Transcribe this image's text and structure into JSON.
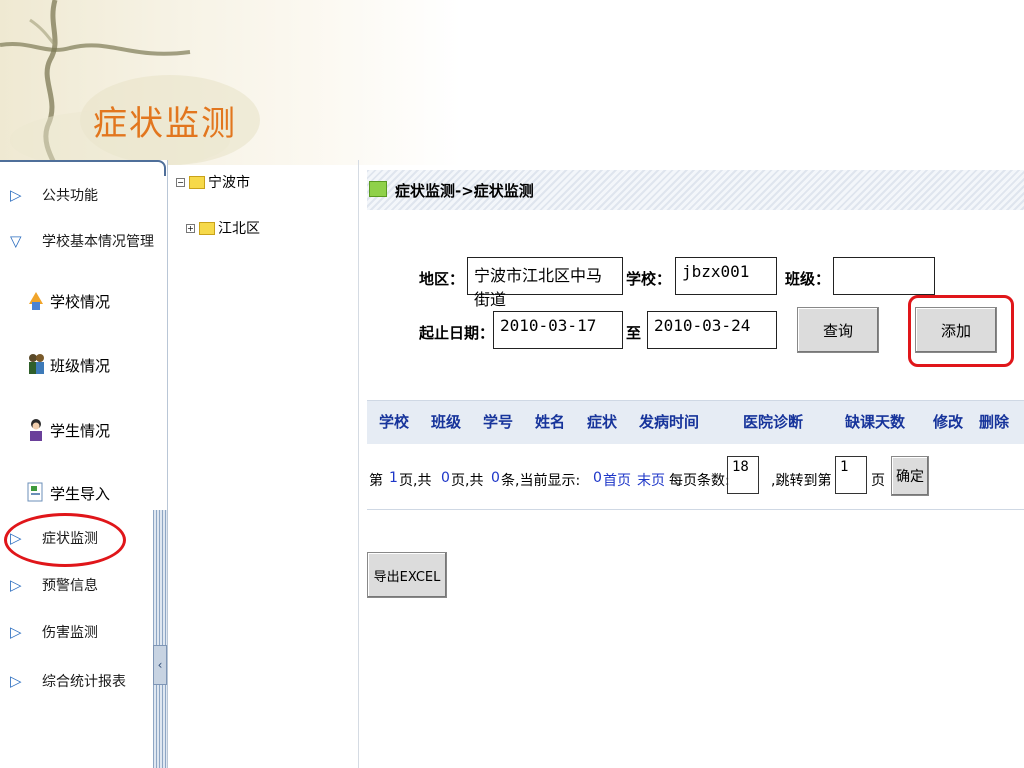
{
  "banner": {
    "title": "症状监测"
  },
  "sidebar": {
    "items": [
      {
        "label": "公共功能",
        "icon": "triangle-right-icon"
      },
      {
        "label": "学校基本情况管理",
        "icon": "triangle-down-icon"
      },
      {
        "label": "症状监测",
        "icon": "triangle-right-icon"
      },
      {
        "label": "预警信息",
        "icon": "triangle-right-icon"
      },
      {
        "label": "伤害监测",
        "icon": "triangle-right-icon"
      },
      {
        "label": "综合统计报表",
        "icon": "triangle-right-icon"
      }
    ],
    "sub_items": [
      {
        "label": "学校情况",
        "icon": "school-icon"
      },
      {
        "label": "班级情况",
        "icon": "class-icon"
      },
      {
        "label": "学生情况",
        "icon": "student-icon"
      },
      {
        "label": "学生导入",
        "icon": "import-icon"
      }
    ],
    "collapse_glyph": "‹"
  },
  "tree": {
    "root": {
      "label": "宁波市",
      "expander": "−"
    },
    "child": {
      "label": "江北区",
      "expander": "+"
    }
  },
  "main": {
    "breadcrumb": "症状监测->症状监测",
    "form": {
      "region_label": "地区：",
      "region_value": "宁波市江北区中马街道",
      "school_label": "学校：",
      "school_value": "jbzx001",
      "class_label": "班级：",
      "class_value": "",
      "date_label": "起止日期：",
      "start_date": "2010-03-17",
      "to_label": "至",
      "end_date": "2010-03-24",
      "query_button": "查询",
      "add_button": "添加"
    },
    "table": {
      "columns": [
        "学校",
        "班级",
        "学号",
        "姓名",
        "症状",
        "发病时间",
        "医院诊断",
        "缺课天数",
        "修改",
        "删除"
      ]
    },
    "pager": {
      "prefix": "第",
      "page_num": "1",
      "page_text": "页,共",
      "total_pages": "0",
      "pages_text": "页,共",
      "total_records": "0",
      "records_text": "条,当前显示:",
      "current_shown": "0",
      "first_page": "首页",
      "last_page": "末页",
      "per_page_label": "每页条数:",
      "per_page_value": "18",
      "jump_label": ",跳转到第",
      "jump_value": "1",
      "page_suffix": "页",
      "confirm_button": "确定"
    },
    "export_button": "导出EXCEL"
  },
  "colors": {
    "title": "#e2761e",
    "highlight": "#e0161a",
    "header_text": "#17349b",
    "link_blue": "#1d36c8"
  }
}
